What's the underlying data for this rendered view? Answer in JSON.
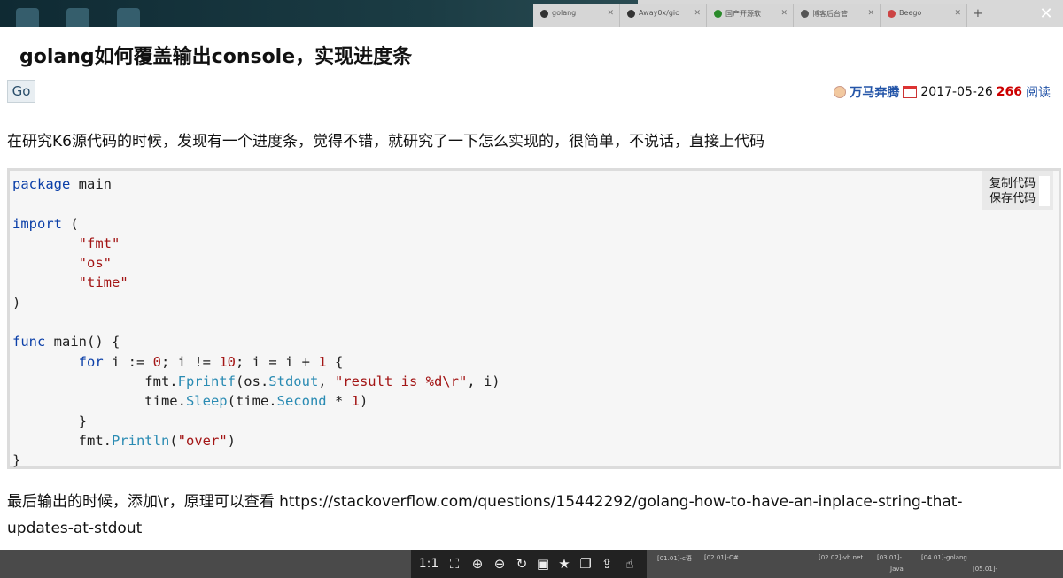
{
  "browser": {
    "tabs": [
      {
        "label": "golang"
      },
      {
        "label": "Away0x/gic"
      },
      {
        "label": "国产开源软"
      },
      {
        "label": "博客后台管"
      },
      {
        "label": "Beego"
      }
    ],
    "new_tab": "+",
    "close": "✕"
  },
  "article": {
    "title": "golang如何覆盖输出console，实现进度条",
    "go_button": "Go",
    "author": "万马奔腾",
    "date": "2017-05-26",
    "views": "266",
    "views_label": "阅读",
    "intro": "在研究K6源代码的时候，发现有一个进度条，觉得不错，就研究了一下怎么实现的，很简单，不说话，直接上代码",
    "outro": "最后输出的时候，添加\\r，原理可以查看 https://stackoverflow.com/questions/15442292/golang-how-to-have-an-inplace-string-that-updates-at-stdout"
  },
  "code": {
    "copy_label": "复制代码",
    "save_label": "保存代码",
    "lines": [
      "package main",
      "",
      "import (",
      "        \"fmt\"",
      "        \"os\"",
      "        \"time\"",
      ")",
      "",
      "func main() {",
      "        for i := 0; i != 10; i = i + 1 {",
      "                fmt.Fprintf(os.Stdout, \"result is %d\\r\", i)",
      "                time.Sleep(time.Second * 1)",
      "        }",
      "        fmt.Println(\"over\")",
      "}"
    ]
  },
  "viewer": {
    "zoom_label": "1:1",
    "taskbar": [
      "[01.01]-c语",
      "[02.01]-C#",
      "[02.02]-vb.net",
      "[03.01]-",
      "[04.01]-golang",
      "Java",
      "[05.01]-"
    ]
  }
}
